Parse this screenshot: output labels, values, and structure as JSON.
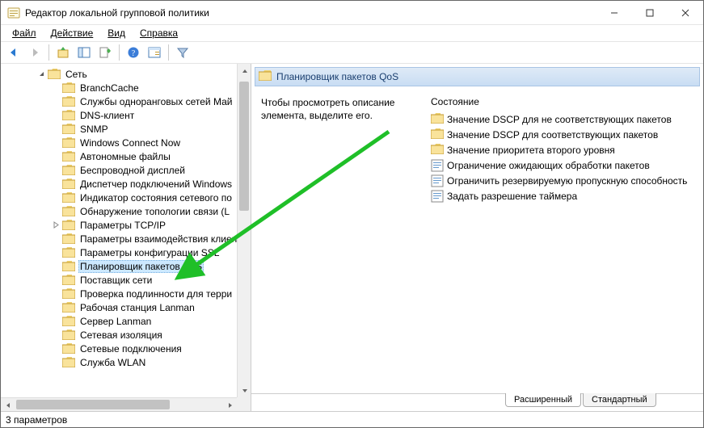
{
  "titlebar": {
    "title": "Редактор локальной групповой политики"
  },
  "menu": {
    "file": "Файл",
    "action": "Действие",
    "view": "Вид",
    "help": "Справка"
  },
  "tree": {
    "root": {
      "label": "Сеть"
    },
    "items": [
      "BranchCache",
      "Службы одноранговых сетей Май",
      "DNS-клиент",
      "SNMP",
      "Windows Connect Now",
      "Автономные файлы",
      "Беспроводной дисплей",
      "Диспетчер подключений Windows",
      "Индикатор состояния сетевого по",
      "Обнаружение топологии связи (L",
      "Параметры TCP/IP",
      "Параметры взаимодействия клиен",
      "Параметры конфигурации SSL",
      "Планировщик пакетов QoS",
      "Поставщик сети",
      "Проверка подлинности для терри",
      "Рабочая станция Lanman",
      "Сервер Lanman",
      "Сетевая изоляция",
      "Сетевые подключения",
      "Служба WLAN"
    ],
    "selected_index": 13,
    "expandable_indices": [
      10
    ]
  },
  "header": {
    "title": "Планировщик пакетов QoS"
  },
  "description": "Чтобы просмотреть описание элемента, выделите его.",
  "state": {
    "heading": "Состояние",
    "items": [
      {
        "type": "folder",
        "label": "Значение DSCP для не соответствующих пакетов"
      },
      {
        "type": "folder",
        "label": "Значение DSCP для соответствующих пакетов"
      },
      {
        "type": "folder",
        "label": "Значение приоритета второго уровня"
      },
      {
        "type": "setting",
        "label": "Ограничение ожидающих обработки пакетов"
      },
      {
        "type": "setting",
        "label": "Ограничить резервируемую пропускную способность"
      },
      {
        "type": "setting",
        "label": "Задать разрешение таймера"
      }
    ]
  },
  "tabs": {
    "extended": "Расширенный",
    "standard": "Стандартный",
    "active": "extended"
  },
  "statusbar": {
    "text": "3 параметров"
  }
}
